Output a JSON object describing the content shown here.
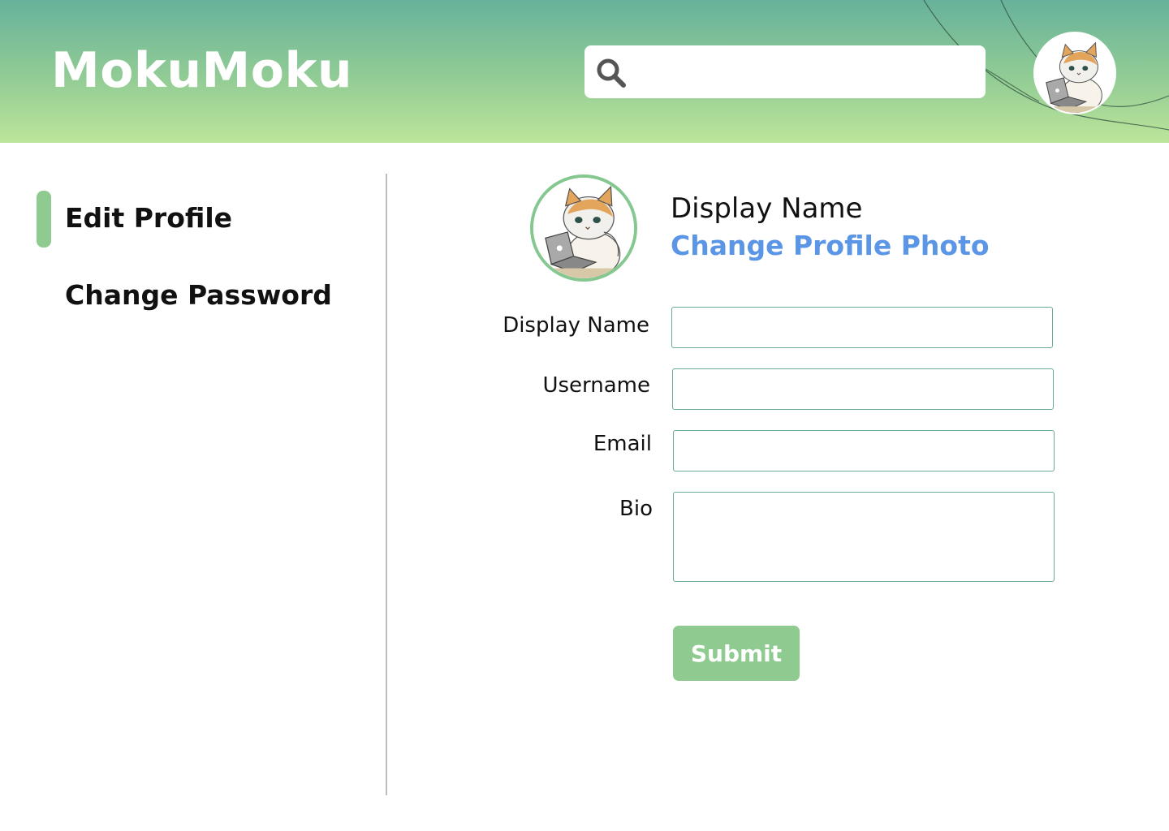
{
  "header": {
    "brand": "MokuMoku",
    "search": {
      "placeholder": "",
      "value": ""
    },
    "avatar_icon": "cat-avatar-icon"
  },
  "sidebar": {
    "items": [
      {
        "label": "Edit Profile",
        "active": true
      },
      {
        "label": "Change Password",
        "active": false
      }
    ]
  },
  "profile": {
    "display_name": "Display Name",
    "change_photo_label": "Change Profile Photo"
  },
  "form": {
    "fields": [
      {
        "label": "Display Name",
        "value": ""
      },
      {
        "label": "Username",
        "value": ""
      },
      {
        "label": "Email",
        "value": ""
      },
      {
        "label": "Bio",
        "value": ""
      }
    ],
    "submit_label": "Submit"
  },
  "colors": {
    "header_gradient_top": "#67b29b",
    "header_gradient_bottom": "#bde59a",
    "accent": "#8fcb91",
    "link": "#5a95e6",
    "input_border": "#6aaa98"
  }
}
